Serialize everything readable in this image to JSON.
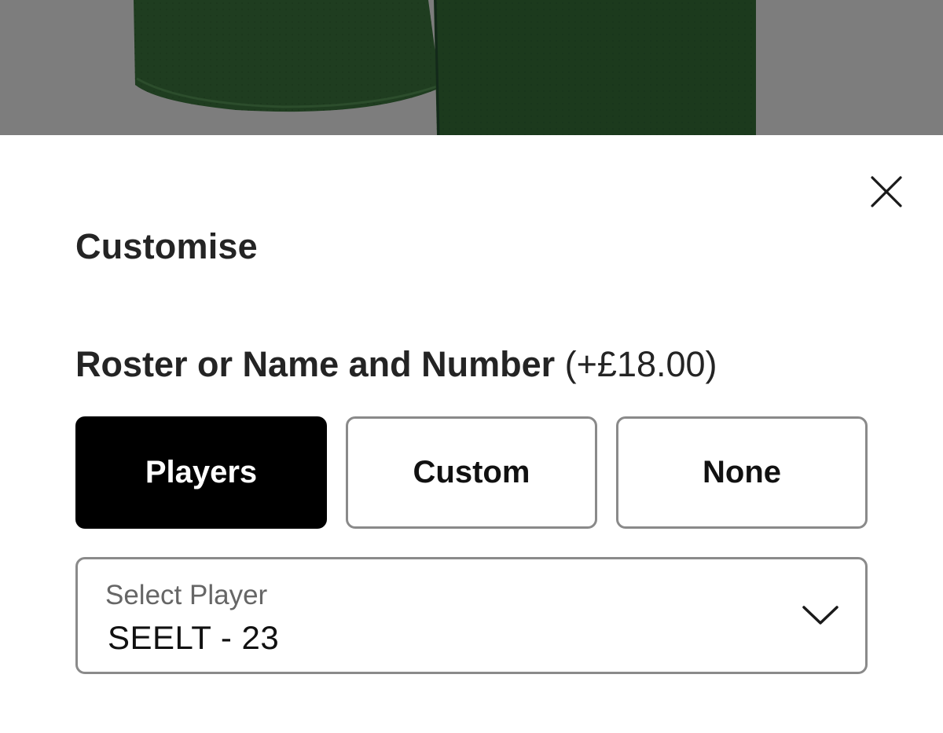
{
  "modal": {
    "title": "Customise",
    "close_icon": "close-icon"
  },
  "roster": {
    "label": "Roster or Name and Number",
    "price": "(+£18.00)",
    "options": [
      {
        "label": "Players",
        "selected": true
      },
      {
        "label": "Custom",
        "selected": false
      },
      {
        "label": "None",
        "selected": false
      }
    ]
  },
  "player_select": {
    "label": "Select Player",
    "value": "SEELT - 23",
    "icon": "chevron-down-icon"
  },
  "colors": {
    "backdrop": "#7d7d7d",
    "jersey": "#1c3a1c",
    "selected_bg": "#000000",
    "border": "#8a8a8a"
  }
}
